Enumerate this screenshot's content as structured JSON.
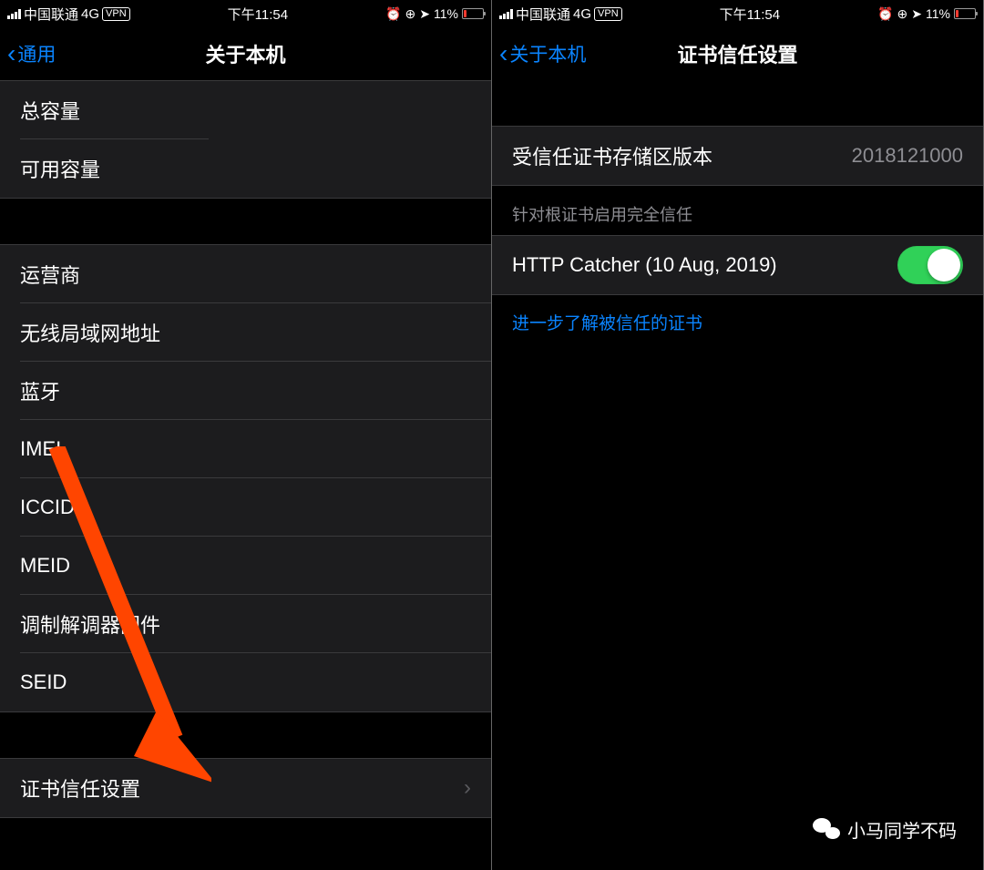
{
  "statusBar": {
    "carrier": "中国联通",
    "network": "4G",
    "vpn": "VPN",
    "time": "下午11:54",
    "batteryPercent": "11%"
  },
  "left": {
    "back": "通用",
    "title": "关于本机",
    "rows": {
      "total_capacity": "总容量",
      "available_capacity": "可用容量",
      "carrier": "运营商",
      "wifi_address": "无线局域网地址",
      "bluetooth": "蓝牙",
      "imei": "IMEI",
      "iccid": "ICCID",
      "meid": "MEID",
      "modem_firmware": "调制解调器固件",
      "seid": "SEID",
      "cert_trust": "证书信任设置"
    }
  },
  "right": {
    "back": "关于本机",
    "title": "证书信任设置",
    "trust_store_label": "受信任证书存储区版本",
    "trust_store_version": "2018121000",
    "section_header": "针对根证书启用完全信任",
    "cert_name": "HTTP Catcher (10 Aug, 2019)",
    "learn_more": "进一步了解被信任的证书"
  },
  "watermark": "小马同学不码"
}
